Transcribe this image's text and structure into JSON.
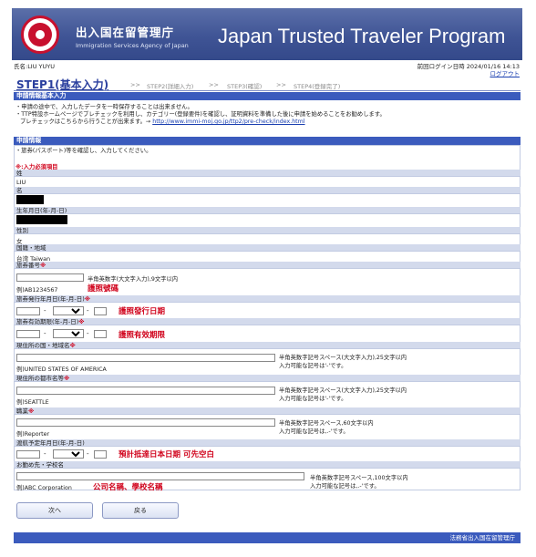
{
  "header": {
    "agency_jp": "出入国在留管理庁",
    "agency_en": "Immigration Services Agency of Japan",
    "program_title": "Japan Trusted Traveler Program"
  },
  "user": {
    "name_line": "氏名:LIU YUYU",
    "last_login": "前回ログイン日時 2024/01/16 14:13",
    "logout": "ログアウト"
  },
  "steps": {
    "active": "STEP1(基本入力)",
    "arrow": ">>",
    "step2": "STEP2(詳細入力)",
    "step3": "STEP3(確認)",
    "step4": "STEP4(登録完了)"
  },
  "section_basic": {
    "title": "申請情報基本入力",
    "note1": "・申請の途中で、入力したデータを一時保存することは出来ません。",
    "note2": "・TTP特設ホームページでプレチェックを利用し、カテゴリー(登録要件)を確認し、証明資料を準備した後に申請を始めることをお勧めします。",
    "note3": "プレチェックはこちらから行うことが出来ます。→",
    "link": "http://www.immi-moj.go.jp/ttp2/pre-check/index.html"
  },
  "section_info": {
    "title": "申請情報",
    "note": "・旅券(パスポート)等を確認し、入力してください。",
    "required_note": "※:入力必須項目"
  },
  "fields": {
    "surname_label": "姓",
    "surname_value": "LIU",
    "given_label": "名",
    "dob_label": "生年月日(年-月-日)",
    "gender_label": "性別",
    "gender_value": "女",
    "nationality_label": "国籍・地域",
    "nationality_value": "台湾 Taiwan",
    "passport_label": "旅券番号",
    "passport_hint": "半角英数字(大文字入力),9文字以内",
    "passport_example": "例)AB1234567",
    "passport_annot": "護照號碼",
    "issue_label": "旅券発行年月日(年-月-日)",
    "issue_annot": "護照發行日期",
    "expiry_label": "旅券有効期限(年-月-日)",
    "expiry_annot": "護照有效期限",
    "country_label": "現住所の国・地域名",
    "country_hint1": "半角英数字記号スペース(大文字入力),25文字以内",
    "country_hint2": "入力可能な記号は'-'です。",
    "country_example": "例)UNITED STATES OF AMERICA",
    "city_label": "現住所の都市名等",
    "city_hint1": "半角英数字記号スペース(大文字入力),25文字以内",
    "city_hint2": "入力可能な記号は'-'です。",
    "city_example": "例)SEATTLE",
    "job_label": "職業",
    "job_hint1": "半角英数字記号スペース,60文字以内",
    "job_hint2": "入力可能な記号は,.-'です。",
    "job_example": "例)Reporter",
    "travel_label": "渡航予定年月日(年-月-日)",
    "travel_annot": "預計抵達日本日期 可先空白",
    "employer_label": "お勤め先・学校名",
    "employer_hint1": "半角英数字記号スペース,100文字以内",
    "employer_hint2": "入力可能な記号は,.-'です。",
    "employer_example": "例)ABC Corporation",
    "employer_annot": "公司名稱、學校名稱",
    "req_mark": "※",
    "dash": "-"
  },
  "buttons": {
    "next": "次へ",
    "back": "戻る"
  },
  "footer": {
    "text": "法務省出入国在留管理庁"
  },
  "colors": {
    "banner": "#3f5495",
    "bar": "#3b5bbd",
    "label_bg": "#d3daec",
    "required": "#d0021b",
    "link": "#1a3fb0"
  }
}
